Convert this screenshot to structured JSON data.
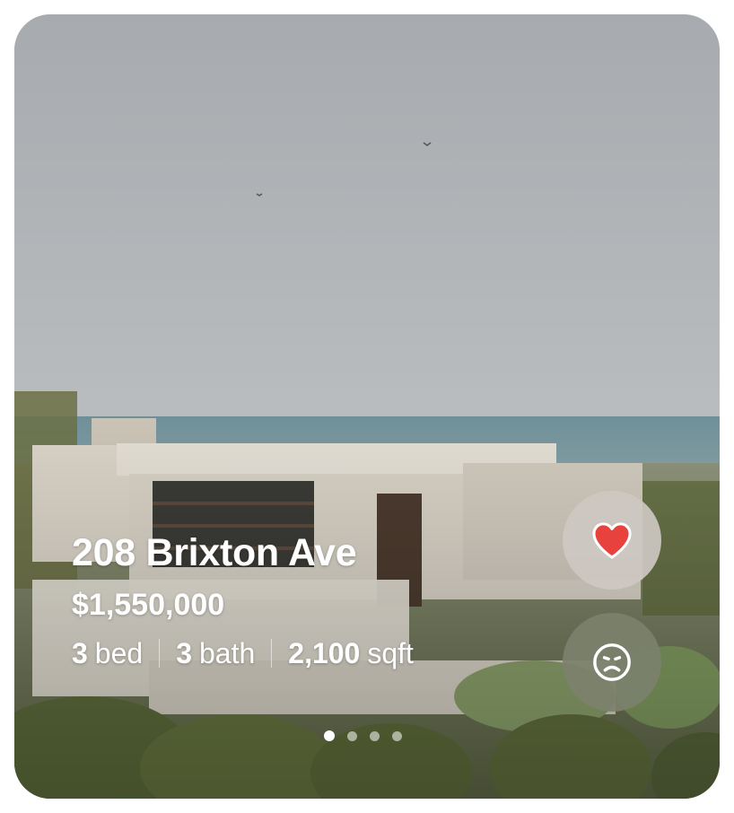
{
  "listing": {
    "address": "208 Brixton Ave",
    "price": "$1,550,000",
    "beds_value": "3",
    "beds_unit": "bed",
    "baths_value": "3",
    "baths_unit": "bath",
    "area_value": "2,100",
    "area_unit": "sqft"
  },
  "actions": {
    "like_icon": "heart-icon",
    "dislike_icon": "sad-face-icon"
  },
  "carousel": {
    "total": 4,
    "active_index": 0
  },
  "colors": {
    "heart": "#e8423f",
    "like_button_bg": "#cdc8c1",
    "dislike_button_bg": "#7c816c",
    "text": "#ffffff"
  }
}
